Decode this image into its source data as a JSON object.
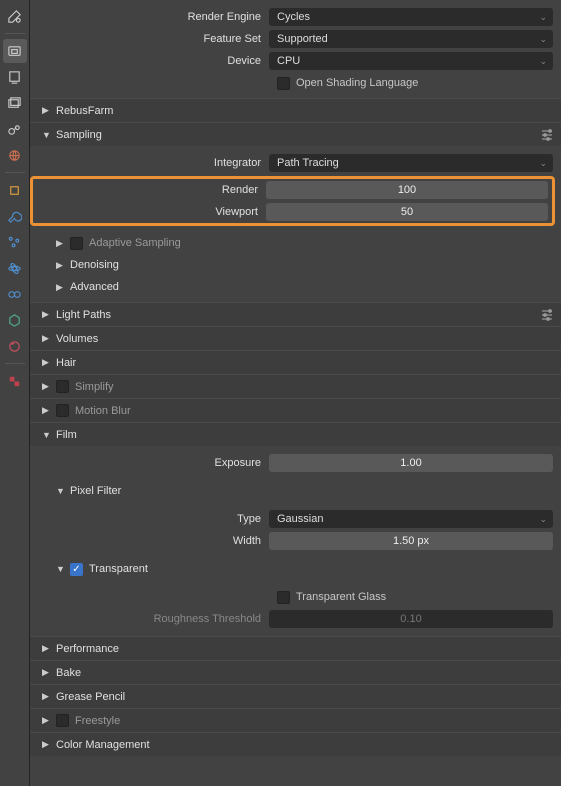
{
  "render": {
    "engine_label": "Render Engine",
    "engine_value": "Cycles",
    "featureset_label": "Feature Set",
    "featureset_value": "Supported",
    "device_label": "Device",
    "device_value": "CPU",
    "osl_label": "Open Shading Language"
  },
  "panels": {
    "rebusfarm": "RebusFarm",
    "sampling": "Sampling",
    "lightpaths": "Light Paths",
    "volumes": "Volumes",
    "hair": "Hair",
    "simplify": "Simplify",
    "motionblur": "Motion Blur",
    "film": "Film",
    "performance": "Performance",
    "bake": "Bake",
    "greasepencil": "Grease Pencil",
    "freestyle": "Freestyle",
    "colormgmt": "Color Management"
  },
  "sampling": {
    "integrator_label": "Integrator",
    "integrator_value": "Path Tracing",
    "render_label": "Render",
    "render_value": "100",
    "viewport_label": "Viewport",
    "viewport_value": "50",
    "adaptive": "Adaptive Sampling",
    "denoising": "Denoising",
    "advanced": "Advanced"
  },
  "film": {
    "exposure_label": "Exposure",
    "exposure_value": "1.00",
    "pixelfilter": "Pixel Filter",
    "type_label": "Type",
    "type_value": "Gaussian",
    "width_label": "Width",
    "width_value": "1.50 px",
    "transparent": "Transparent",
    "transparent_glass": "Transparent Glass",
    "roughness_label": "Roughness Threshold",
    "roughness_value": "0.10"
  }
}
